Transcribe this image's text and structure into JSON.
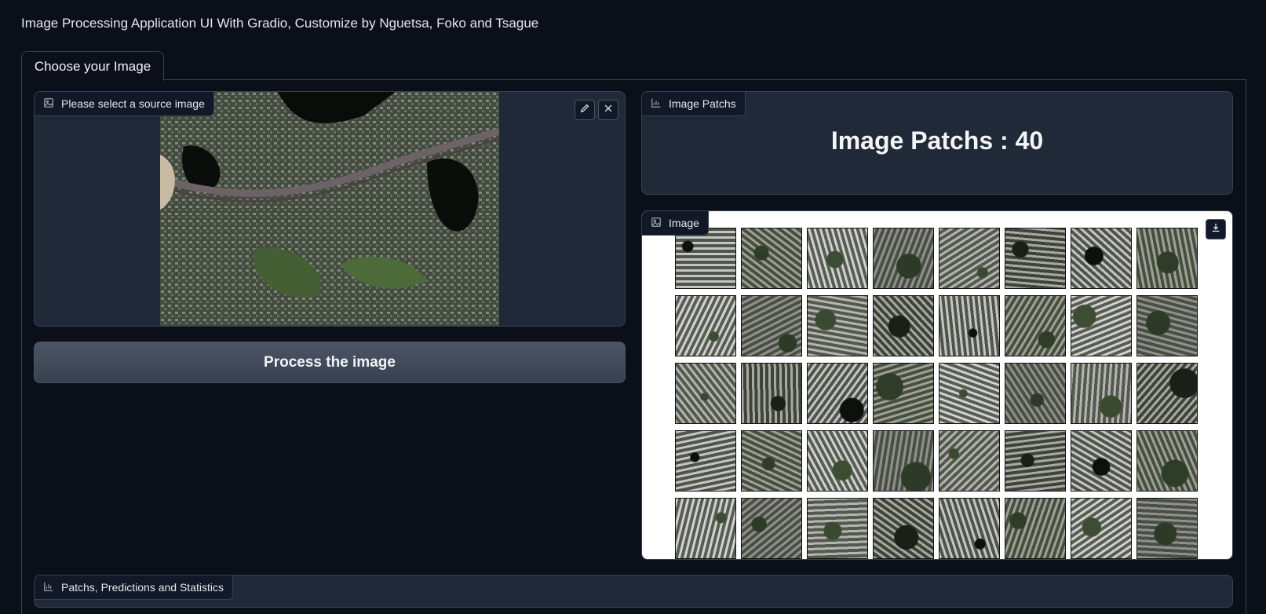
{
  "app": {
    "title": "Image Processing Application UI With Gradio, Customize by Nguetsa, Foko and Tsague"
  },
  "tabs": [
    {
      "label": "Choose your Image",
      "active": true
    }
  ],
  "source": {
    "label": "Please select a source image",
    "icon": "image-icon",
    "actions": [
      "pencil-icon",
      "close-icon"
    ]
  },
  "process_button": {
    "label": "Process the image"
  },
  "patch_count": {
    "label": "Image Patchs",
    "icon": "chart-icon",
    "text": "Image Patchs : 40",
    "count": 40
  },
  "gallery": {
    "label": "Image",
    "icon": "image-icon",
    "download_icon": "download-icon",
    "rows": 5,
    "cols": 8
  },
  "stats": {
    "label": "Patchs, Predictions and Statistics",
    "icon": "chart-icon"
  },
  "colors": {
    "background": "#0b0f19",
    "block": "#1f2937",
    "border": "#374151",
    "button": "#4b5563"
  }
}
